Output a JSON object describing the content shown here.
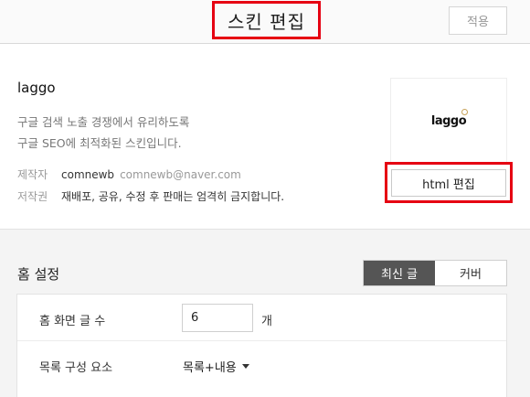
{
  "header": {
    "title": "스킨 편집",
    "apply_label": "적용"
  },
  "skin": {
    "name": "laggo",
    "description_lines": [
      "구글 검색 노출 경쟁에서 유리하도록",
      "구글 SEO에 최적화된 스킨입니다."
    ],
    "author_label": "제작자",
    "author_name": "comnewb",
    "author_email": "comnewb@naver.com",
    "copyright_label": "저작권",
    "copyright_text": "재배포, 공유, 수정 후 판매는 엄격히 금지합니다.",
    "thumbnail_text": "laggo",
    "html_edit_label": "html 편집"
  },
  "home": {
    "title": "홈 설정",
    "tabs": [
      {
        "label": "최신 글",
        "active": true
      },
      {
        "label": "커버",
        "active": false
      }
    ],
    "post_count_label": "홈 화면 글 수",
    "post_count_value": "6",
    "post_count_unit": "개",
    "list_layout_label": "목록 구성 요소",
    "list_layout_value": "목록+내용"
  },
  "colors": {
    "highlight": "#e60012",
    "active_tab": "#555555"
  }
}
